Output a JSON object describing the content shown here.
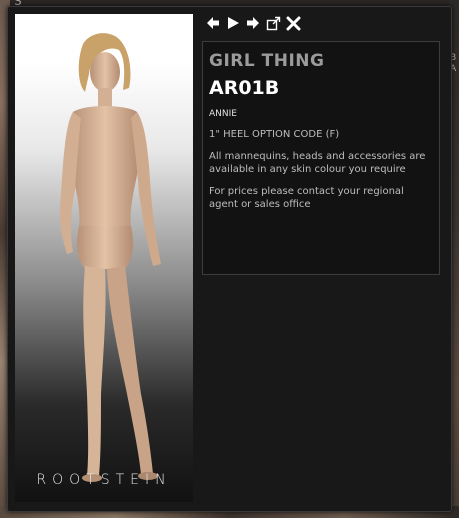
{
  "background": {
    "top_glyph": "S",
    "right_letters": "l\nB\nA"
  },
  "toolbar": {
    "prev_icon": "arrow-left-icon",
    "play_icon": "play-icon",
    "next_icon": "arrow-right-icon",
    "popout_icon": "external-window-icon",
    "close_icon": "close-icon"
  },
  "photo": {
    "brand": "ROOTSTEIN"
  },
  "info": {
    "collection": "GIRL THING",
    "code": "AR01B",
    "name": "ANNIE",
    "heel": "1\" HEEL OPTION CODE (F)",
    "colour_note": "All mannequins, heads and accessories are available in any skin colour you require",
    "price_note": "For prices please contact your regional agent or sales office"
  }
}
